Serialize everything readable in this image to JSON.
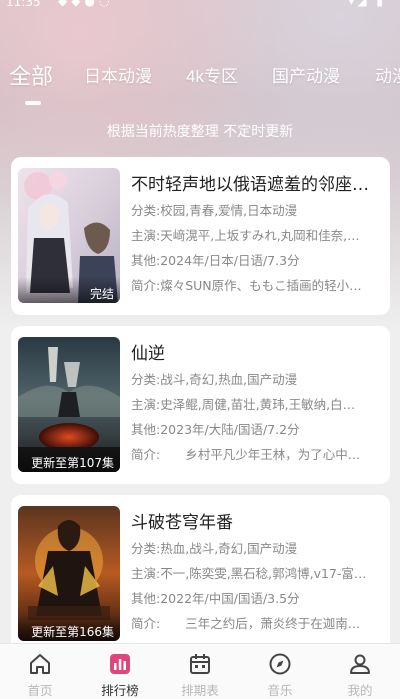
{
  "status_bar": {
    "time": "11:35",
    "left_icons": "◆◆●◌",
    "right_icons": "▾◢ ▮"
  },
  "tabs": [
    {
      "label": "全部",
      "active": true
    },
    {
      "label": "日本动漫",
      "active": false
    },
    {
      "label": "4k专区",
      "active": false
    },
    {
      "label": "国产动漫",
      "active": false
    },
    {
      "label": "动漫",
      "active": false
    }
  ],
  "subtitle": "根据当前热度整理 不定时更新",
  "cards": [
    {
      "title": "不时轻声地以俄语遮羞的邻座…",
      "category_label": "分类:",
      "category": "校园,青春,爱情,日本动漫",
      "cast_label": "主演:",
      "cast": "天﨑滉平,上坂すみれ,丸岡和佳奈,…",
      "other_label": "其他:",
      "other": "2024年/日本/日语/7.3分",
      "intro_label": "简介:",
      "intro": "燦々SUN原作、ももこ插画的轻小…",
      "badge": "完结",
      "cover_colors": [
        "#e8dde6",
        "#b9b2c4",
        "#5a5f7a"
      ]
    },
    {
      "title": "仙逆",
      "category_label": "分类:",
      "category": "战斗,奇幻,热血,国产动漫",
      "cast_label": "主演:",
      "cast": "史泽鲲,周健,苗壮,黄玮,王敏纳,白…",
      "other_label": "其他:",
      "other": "2023年/大陆/国语/7.2分",
      "intro_label": "简介:",
      "intro": "　　乡村平凡少年王林，为了心中…",
      "badge": "更新至第107集",
      "cover_colors": [
        "#1f2a33",
        "#4b5a5e",
        "#8a2e1c"
      ]
    },
    {
      "title": "斗破苍穹年番",
      "category_label": "分类:",
      "category": "热血,战斗,奇幻,国产动漫",
      "cast_label": "主演:",
      "cast": "不一,陈奕雯,黑石稔,郭鸿博,v17-富…",
      "other_label": "其他:",
      "other": "2022年/中国/国语/3.5分",
      "intro_label": "简介:",
      "intro": "　　三年之约后，萧炎终于在迦南…",
      "badge": "更新至第166集",
      "cover_colors": [
        "#3a1e12",
        "#c2631e",
        "#f0b03a"
      ]
    }
  ],
  "bottom_nav": [
    {
      "label": "首页",
      "icon": "home-icon",
      "active": false
    },
    {
      "label": "排行榜",
      "icon": "ranking-icon",
      "active": true
    },
    {
      "label": "排期表",
      "icon": "calendar-icon",
      "active": false
    },
    {
      "label": "音乐",
      "icon": "compass-icon",
      "active": false
    },
    {
      "label": "我的",
      "icon": "user-icon",
      "active": false
    }
  ],
  "colors": {
    "accent": "#e0457b",
    "nav_inactive": "#b8b8b8",
    "nav_active": "#333333"
  }
}
